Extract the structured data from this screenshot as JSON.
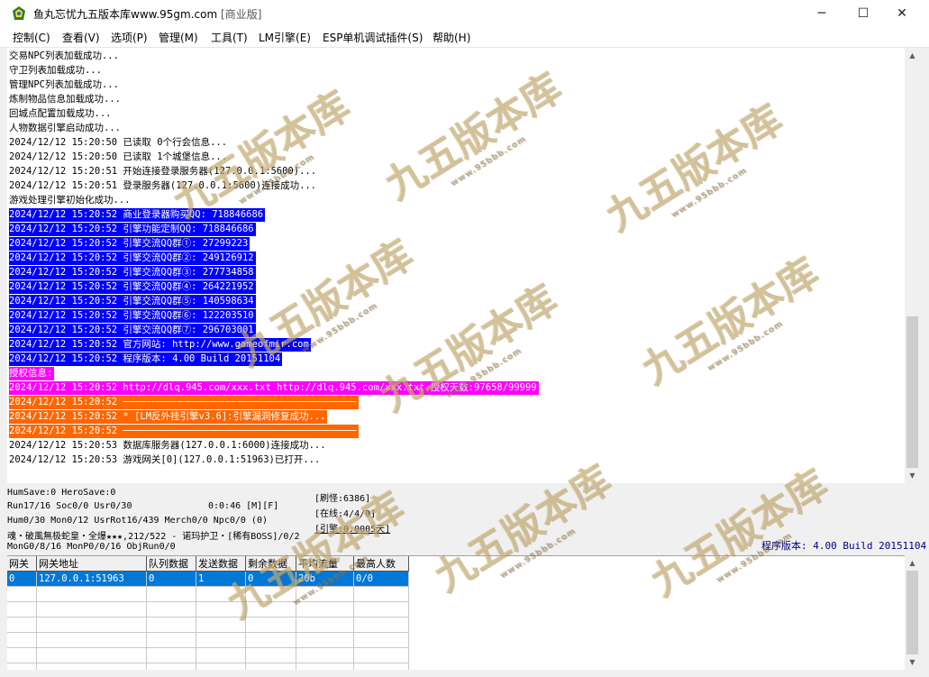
{
  "window": {
    "title": "鱼丸忘忧九五版本库www.95gm.com",
    "title_suffix": "[商业版]",
    "controls": {
      "minimize": "─",
      "maximize": "☐",
      "close": "✕"
    }
  },
  "menu": [
    "控制(C)",
    "查看(V)",
    "选项(P)",
    "管理(M)",
    "工具(T)",
    "LM引擎(E)",
    "ESP单机调试插件(S)",
    "帮助(H)"
  ],
  "log": [
    {
      "text": "交易NPC列表加载成功...",
      "style": "plain"
    },
    {
      "text": "守卫列表加载成功...",
      "style": "plain"
    },
    {
      "text": "管理NPC列表加载成功...",
      "style": "plain"
    },
    {
      "text": "炼制物品信息加载成功...",
      "style": "plain"
    },
    {
      "text": "回城点配置加载成功...",
      "style": "plain"
    },
    {
      "text": "人物数据引擎启动成功...",
      "style": "plain"
    },
    {
      "text": "2024/12/12 15:20:50 已读取 0个行会信息...",
      "style": "plain"
    },
    {
      "text": "2024/12/12 15:20:50 已读取 1个城堡信息...",
      "style": "plain"
    },
    {
      "text": "2024/12/12 15:20:51 开始连接登录服务器(127.0.0.1:5600)...",
      "style": "plain"
    },
    {
      "text": "2024/12/12 15:20:51 登录服务器(127.0.0.1:5600)连接成功...",
      "style": "plain"
    },
    {
      "text": "游戏处理引擎初始化成功...",
      "style": "plain"
    },
    {
      "text": "2024/12/12 15:20:52 商业登录器购买QQ: 718846686",
      "style": "blue"
    },
    {
      "text": "2024/12/12 15:20:52 引擎功能定制QQ: 718846686",
      "style": "blue"
    },
    {
      "text": "2024/12/12 15:20:52 引擎交流QQ群①: 27299223",
      "style": "blue"
    },
    {
      "text": "2024/12/12 15:20:52 引擎交流QQ群②: 249126912",
      "style": "blue"
    },
    {
      "text": "2024/12/12 15:20:52 引擎交流QQ群③: 277734858",
      "style": "blue"
    },
    {
      "text": "2024/12/12 15:20:52 引擎交流QQ群④: 264221952",
      "style": "blue"
    },
    {
      "text": "2024/12/12 15:20:52 引擎交流QQ群⑤: 140598634",
      "style": "blue"
    },
    {
      "text": "2024/12/12 15:20:52 引擎交流QQ群⑥: 122203510",
      "style": "blue"
    },
    {
      "text": "2024/12/12 15:20:52 引擎交流QQ群⑦: 296703001",
      "style": "blue"
    },
    {
      "text": "2024/12/12 15:20:52 官方网站: http://www.gameofmir.com",
      "style": "blue"
    },
    {
      "text": "2024/12/12 15:20:52 程序版本: 4.00 Build 20151104",
      "style": "blue"
    },
    {
      "text": "授权信息:",
      "style": "magenta"
    },
    {
      "text": "2024/12/12 15:20:52 http://dlq.945.com/xxx.txt http://dlq.945.com/xxx.txt 授权天数:97658/99999",
      "style": "magenta"
    },
    {
      "text": "2024/12/12 15:20:52 ─────────────────────────────────────────",
      "style": "orange"
    },
    {
      "text": "2024/12/12 15:20:52 * [LM反外挂引擎v3.6]:引擎漏洞修复成功...",
      "style": "orange"
    },
    {
      "text": "2024/12/12 15:20:52 ─────────────────────────────────────────",
      "style": "orange"
    },
    {
      "text": "2024/12/12 15:20:53 数据库服务器(127.0.0.1:6000)连接成功...",
      "style": "plain"
    },
    {
      "text": "2024/12/12 15:20:53 游戏网关[0](127.0.0.1:51963)已打开...",
      "style": "plain"
    }
  ],
  "colors": {
    "blue": "#0000ff",
    "magenta": "#ff00ff",
    "orange": "#ff6600",
    "text_on_color": "#ffffff",
    "selection": "#0078d7"
  },
  "status": {
    "line1": "HumSave:0 HeroSave:0",
    "line2a": "Run17/16 Soc0/0 Usr0/30",
    "line2b": "0:0:46 [M][F]",
    "line3": "Hum0/30 Mon0/12 UsrRot16/439 Merch0/0 Npc0/0 (0)",
    "line4": "魂・破風無极蛇皇・全爆★★★,212/522 - 诺玛护卫・[稀有BOSS]/0/2",
    "line5": "MonG0/8/16 MonP0/0/16 ObjRun0/0",
    "refresh": "[刷怪:6386]",
    "online": "[在线:4/4/0]",
    "engine": "[引擎:0.0005天]",
    "version": "程序版本: 4.00 Build 20151104"
  },
  "grid": {
    "columns": [
      "网关",
      "网关地址",
      "队列数据",
      "发送数据",
      "剩余数据",
      "平均流量",
      "最高人数"
    ],
    "rows": [
      [
        "0",
        "127.0.0.1:51963",
        "0",
        "1",
        "0",
        "20b",
        "0/0"
      ]
    ]
  },
  "watermark": {
    "text": "九五版本库",
    "sub": "www.95bbb.com"
  }
}
